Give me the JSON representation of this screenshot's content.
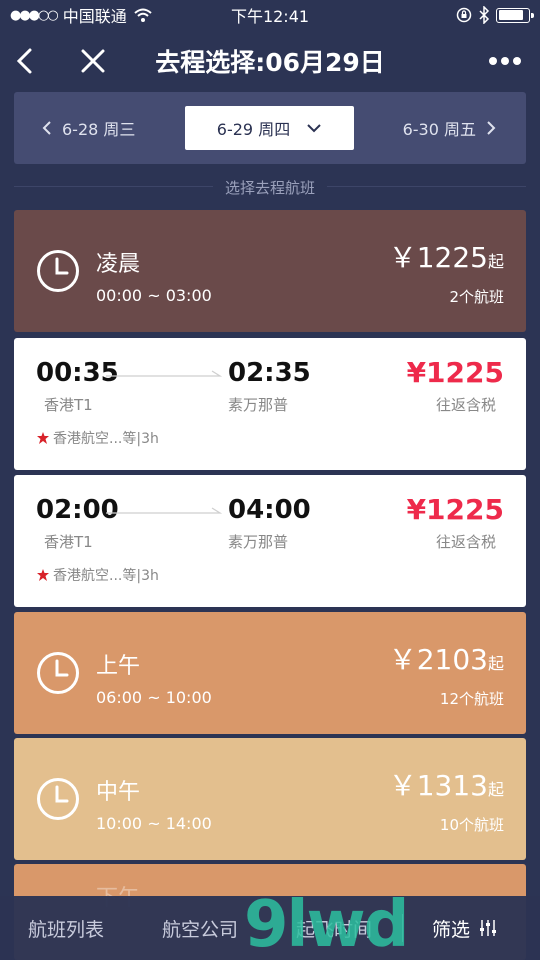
{
  "status_bar": {
    "carrier": "中国联通",
    "time": "下午12:41"
  },
  "nav": {
    "title": "去程选择:06月29日"
  },
  "dates": {
    "prev": "6-28 周三",
    "current": "6-29 周四",
    "next": "6-30 周五"
  },
  "section_label": "选择去程航班",
  "periods": [
    {
      "name": "凌晨",
      "range": "00:00 ~ 03:00",
      "price": "￥1225",
      "suffix": "起",
      "count": "2个航班",
      "color": "#6a4a4a"
    },
    {
      "name": "上午",
      "range": "06:00 ~ 10:00",
      "price": "￥2103",
      "suffix": "起",
      "count": "12个航班",
      "color": "#d9986a"
    },
    {
      "name": "中午",
      "range": "10:00 ~ 14:00",
      "price": "￥1313",
      "suffix": "起",
      "count": "10个航班",
      "color": "#e3bf8e"
    },
    {
      "name": "下午",
      "color": "#d9986a"
    }
  ],
  "flights": [
    {
      "dep_time": "00:35",
      "dep_airport": "香港T1",
      "arr_time": "02:35",
      "arr_airport": "素万那普",
      "price": "¥1225",
      "note": "往返含税",
      "airline": "香港航空...等|3h"
    },
    {
      "dep_time": "02:00",
      "dep_airport": "香港T1",
      "arr_time": "04:00",
      "arr_airport": "素万那普",
      "price": "¥1225",
      "note": "往返含税",
      "airline": "香港航空...等|3h"
    }
  ],
  "bottom_tabs": {
    "list": "航班列表",
    "airline": "航空公司",
    "time": "起飞时间",
    "filter": "筛选"
  },
  "watermark": "9lwd"
}
